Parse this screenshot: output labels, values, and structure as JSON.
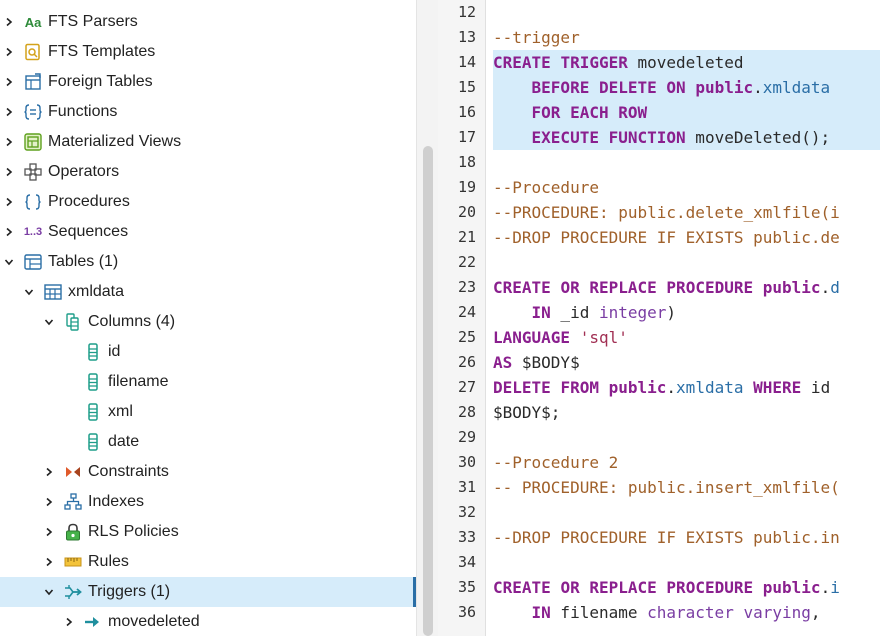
{
  "tree": {
    "items": [
      {
        "label": "FTS Parsers",
        "icon": "fts-parser-icon",
        "expanded": false
      },
      {
        "label": "FTS Templates",
        "icon": "fts-template-icon",
        "expanded": false
      },
      {
        "label": "Foreign Tables",
        "icon": "foreign-table-icon",
        "expanded": false
      },
      {
        "label": "Functions",
        "icon": "function-icon",
        "expanded": false
      },
      {
        "label": "Materialized Views",
        "icon": "materialized-view-icon",
        "expanded": false
      },
      {
        "label": "Operators",
        "icon": "operator-icon",
        "expanded": false
      },
      {
        "label": "Procedures",
        "icon": "procedure-icon",
        "expanded": false
      },
      {
        "label": "Sequences",
        "icon": "sequence-icon",
        "expanded": false
      },
      {
        "label": "Tables (1)",
        "icon": "tables-icon",
        "expanded": true
      },
      {
        "label": "xmldata",
        "icon": "table-icon",
        "expanded": true
      },
      {
        "label": "Columns (4)",
        "icon": "columns-icon",
        "expanded": true
      },
      {
        "label": "id",
        "icon": "column-icon",
        "expanded": null
      },
      {
        "label": "filename",
        "icon": "column-icon",
        "expanded": null
      },
      {
        "label": "xml",
        "icon": "column-icon",
        "expanded": null
      },
      {
        "label": "date",
        "icon": "column-icon",
        "expanded": null
      },
      {
        "label": "Constraints",
        "icon": "constraints-icon",
        "expanded": false
      },
      {
        "label": "Indexes",
        "icon": "indexes-icon",
        "expanded": false
      },
      {
        "label": "RLS Policies",
        "icon": "rls-policy-icon",
        "expanded": false
      },
      {
        "label": "Rules",
        "icon": "rules-icon",
        "expanded": false
      },
      {
        "label": "Triggers (1)",
        "icon": "triggers-icon",
        "expanded": true,
        "selected": true
      },
      {
        "label": "movedeleted",
        "icon": "trigger-icon",
        "expanded": false
      }
    ],
    "icon_text": {
      "fts_parsers": "Aa",
      "sequences": "1..3"
    }
  },
  "editor": {
    "lines": [
      {
        "n": "12",
        "text": ""
      },
      {
        "n": "13",
        "text": "--trigger"
      },
      {
        "n": "14",
        "text": "CREATE TRIGGER movedeleted"
      },
      {
        "n": "15",
        "text": "    BEFORE DELETE ON public.xmldata"
      },
      {
        "n": "16",
        "text": "    FOR EACH ROW"
      },
      {
        "n": "17",
        "text": "    EXECUTE FUNCTION moveDeleted();"
      },
      {
        "n": "18",
        "text": ""
      },
      {
        "n": "19",
        "text": "--Procedure"
      },
      {
        "n": "20",
        "text": "--PROCEDURE: public.delete_xmlfile(i"
      },
      {
        "n": "21",
        "text": "--DROP PROCEDURE IF EXISTS public.de"
      },
      {
        "n": "22",
        "text": ""
      },
      {
        "n": "23",
        "text": "CREATE OR REPLACE PROCEDURE public.d"
      },
      {
        "n": "24",
        "text": "    IN _id integer)"
      },
      {
        "n": "25",
        "text": "LANGUAGE 'sql'"
      },
      {
        "n": "26",
        "text": "AS $BODY$"
      },
      {
        "n": "27",
        "text": "DELETE FROM public.xmldata WHERE id"
      },
      {
        "n": "28",
        "text": "$BODY$;"
      },
      {
        "n": "29",
        "text": ""
      },
      {
        "n": "30",
        "text": "--Procedure 2"
      },
      {
        "n": "31",
        "text": "-- PROCEDURE: public.insert_xmlfile("
      },
      {
        "n": "32",
        "text": ""
      },
      {
        "n": "33",
        "text": "--DROP PROCEDURE IF EXISTS public.in"
      },
      {
        "n": "34",
        "text": ""
      },
      {
        "n": "35",
        "text": "CREATE OR REPLACE PROCEDURE public.i"
      },
      {
        "n": "36",
        "text": "    IN filename character varying,"
      }
    ],
    "highlighted_lines": [
      "14",
      "15",
      "16",
      "17"
    ]
  },
  "colors": {
    "keyword": "#8a1f8e",
    "comment": "#a0612b",
    "string": "#a12f53",
    "identifier": "#2a6ea6",
    "selection": "#d6ecfa"
  }
}
